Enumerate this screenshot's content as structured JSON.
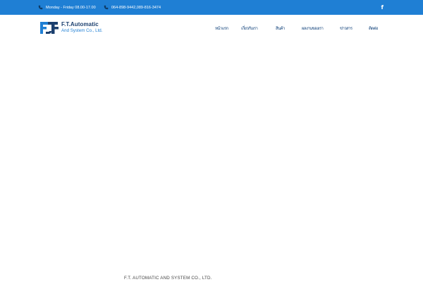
{
  "topbar": {
    "hours_icon": "phone-handset-icon",
    "hours_text": "Monday - Friday 08.00-17.00",
    "phone_icon": "phone-icon",
    "phone_text": "064-898-9442,089-816-3474",
    "social_icon": "facebook-icon",
    "social_label": "f"
  },
  "logo": {
    "line1": "F.T.Automatic",
    "line2": "And System Co., Ltd."
  },
  "nav": {
    "items": [
      {
        "label": "หน้าแรก"
      },
      {
        "label": "เกี่ยวกับเรา"
      },
      {
        "label": "สินค้า"
      },
      {
        "label": "ผลงานของเรา"
      },
      {
        "label": "ข่าวสาร"
      },
      {
        "label": "ติดต่อ"
      }
    ]
  },
  "footer": {
    "company": "F.T. AUTOMATIC AND SYSTEM CO., LTD."
  },
  "colors": {
    "topbar_bg": "#1f7fd4",
    "brand_dark": "#1b3f6e",
    "brand_blue": "#1f7fd4"
  }
}
